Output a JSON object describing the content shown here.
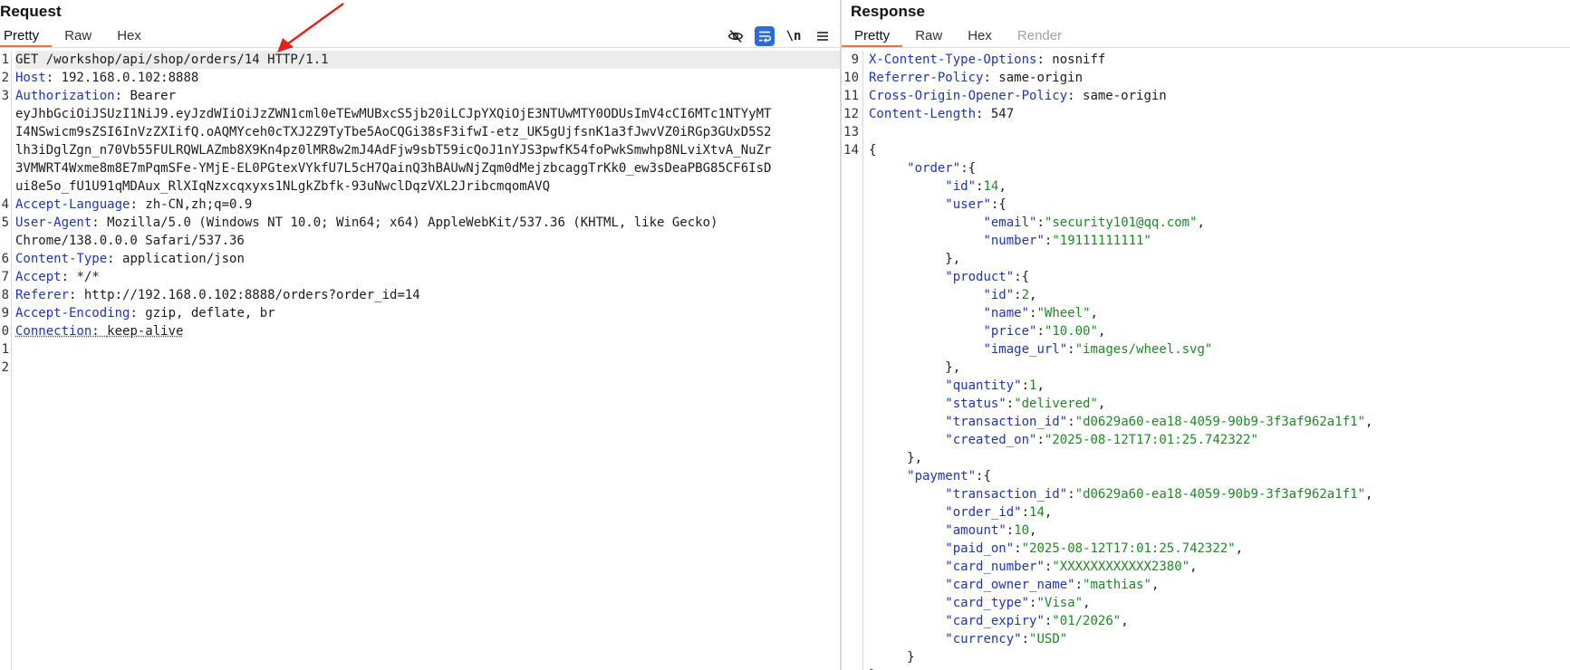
{
  "request": {
    "title": "Request",
    "tabs": [
      {
        "label": "Pretty",
        "active": true
      },
      {
        "label": "Raw",
        "active": false
      },
      {
        "label": "Hex",
        "active": false
      }
    ],
    "toolbar": {
      "hide_icon": "eye-slash-icon",
      "wrap_icon": "word-wrap-icon",
      "newline_label": "\\n",
      "menu_icon": "hamburger-menu-icon",
      "accent": "#2d6bd6"
    },
    "gutter": [
      "1",
      "2",
      "3",
      "",
      "",
      "",
      "",
      "",
      "4",
      "5",
      "",
      "6",
      "7",
      "8",
      "9",
      "0",
      "1",
      "2"
    ],
    "lines": [
      {
        "type": "request-line",
        "text": "GET /workshop/api/shop/orders/14 HTTP/1.1"
      },
      {
        "type": "header",
        "name": "Host",
        "value": "192.168.0.102:8888"
      },
      {
        "type": "header",
        "name": "Authorization",
        "value": "Bearer"
      },
      {
        "type": "cont",
        "text": "eyJhbGciOiJSUzI1NiJ9.eyJzdWIiOiJzZWN1cml0eTEwMUBxcS5jb20iLCJpYXQiOjE3NTUwMTY0ODUsImV4cCI6MTc1NTYyMT"
      },
      {
        "type": "cont",
        "text": "I4NSwicm9sZSI6InVzZXIifQ.oAQMYceh0cTXJ2Z9TyTbe5AoCQGi38sF3ifwI-etz_UK5gUjfsnK1a3fJwvVZ0iRGp3GUxD5S2"
      },
      {
        "type": "cont",
        "text": "lh3iDglZgn_n70Vb55FULRQWLAZmb8X9Kn4pz0lMR8w2mJ4AdFjw9sbT59icQoJ1nYJS3pwfK54foPwkSmwhp8NLviXtvA_NuZr"
      },
      {
        "type": "cont",
        "text": "3VMWRT4Wxme8m8E7mPqmSFe-YMjE-EL0PGtexVYkfU7L5cH7QainQ3hBAUwNjZqm0dMejzbcaggTrKk0_ew3sDeaPBG85CF6IsD"
      },
      {
        "type": "cont",
        "text": "ui8e5o_fU1U91qMDAux_RlXIqNzxcqxyxs1NLgkZbfk-93uNwclDqzVXL2JribcmqomAVQ"
      },
      {
        "type": "header",
        "name": "Accept-Language",
        "value": "zh-CN,zh;q=0.9"
      },
      {
        "type": "header",
        "name": "User-Agent",
        "value": "Mozilla/5.0 (Windows NT 10.0; Win64; x64) AppleWebKit/537.36 (KHTML, like Gecko)"
      },
      {
        "type": "cont",
        "text": "Chrome/138.0.0.0 Safari/537.36"
      },
      {
        "type": "header",
        "name": "Content-Type",
        "value": "application/json"
      },
      {
        "type": "header",
        "name": "Accept",
        "value": "*/*"
      },
      {
        "type": "header",
        "name": "Referer",
        "value": "http://192.168.0.102:8888/orders?order_id=14"
      },
      {
        "type": "header",
        "name": "Accept-Encoding",
        "value": "gzip, deflate, br"
      },
      {
        "type": "header",
        "name": "Connection",
        "value": "keep-alive",
        "underline": true
      },
      {
        "type": "blank"
      },
      {
        "type": "blank"
      }
    ]
  },
  "response": {
    "title": "Response",
    "tabs": [
      {
        "label": "Pretty",
        "active": true
      },
      {
        "label": "Raw",
        "active": false
      },
      {
        "label": "Hex",
        "active": false
      },
      {
        "label": "Render",
        "active": false,
        "disabled": true
      }
    ],
    "lines": [
      {
        "n": "9",
        "type": "header",
        "name": "X-Content-Type-Options",
        "value": "nosniff"
      },
      {
        "n": "10",
        "type": "header",
        "name": "Referrer-Policy",
        "value": "same-origin"
      },
      {
        "n": "11",
        "type": "header",
        "name": "Cross-Origin-Opener-Policy",
        "value": "same-origin"
      },
      {
        "n": "12",
        "type": "header",
        "name": "Content-Length",
        "value": "547"
      },
      {
        "n": "13",
        "type": "blank"
      },
      {
        "n": "14",
        "type": "json",
        "indent": 0,
        "pre": "{"
      },
      {
        "n": "",
        "type": "json",
        "indent": 1,
        "key": "order",
        "pre": ":{"
      },
      {
        "n": "",
        "type": "json",
        "indent": 2,
        "key": "id",
        "num": "14",
        "post": ","
      },
      {
        "n": "",
        "type": "json",
        "indent": 2,
        "key": "user",
        "pre": ":{"
      },
      {
        "n": "",
        "type": "json",
        "indent": 3,
        "key": "email",
        "str": "security101@qq.com",
        "post": ","
      },
      {
        "n": "",
        "type": "json",
        "indent": 3,
        "key": "number",
        "str": "19111111111"
      },
      {
        "n": "",
        "type": "json",
        "indent": 2,
        "pre": "},"
      },
      {
        "n": "",
        "type": "json",
        "indent": 2,
        "key": "product",
        "pre": ":{"
      },
      {
        "n": "",
        "type": "json",
        "indent": 3,
        "key": "id",
        "num": "2",
        "post": ","
      },
      {
        "n": "",
        "type": "json",
        "indent": 3,
        "key": "name",
        "str": "Wheel",
        "post": ","
      },
      {
        "n": "",
        "type": "json",
        "indent": 3,
        "key": "price",
        "str": "10.00",
        "post": ","
      },
      {
        "n": "",
        "type": "json",
        "indent": 3,
        "key": "image_url",
        "str": "images/wheel.svg"
      },
      {
        "n": "",
        "type": "json",
        "indent": 2,
        "pre": "},"
      },
      {
        "n": "",
        "type": "json",
        "indent": 2,
        "key": "quantity",
        "num": "1",
        "post": ","
      },
      {
        "n": "",
        "type": "json",
        "indent": 2,
        "key": "status",
        "str": "delivered",
        "post": ","
      },
      {
        "n": "",
        "type": "json",
        "indent": 2,
        "key": "transaction_id",
        "str": "d0629a60-ea18-4059-90b9-3f3af962a1f1",
        "post": ","
      },
      {
        "n": "",
        "type": "json",
        "indent": 2,
        "key": "created_on",
        "str": "2025-08-12T17:01:25.742322"
      },
      {
        "n": "",
        "type": "json",
        "indent": 1,
        "pre": "},"
      },
      {
        "n": "",
        "type": "json",
        "indent": 1,
        "key": "payment",
        "pre": ":{"
      },
      {
        "n": "",
        "type": "json",
        "indent": 2,
        "key": "transaction_id",
        "str": "d0629a60-ea18-4059-90b9-3f3af962a1f1",
        "post": ","
      },
      {
        "n": "",
        "type": "json",
        "indent": 2,
        "key": "order_id",
        "num": "14",
        "post": ","
      },
      {
        "n": "",
        "type": "json",
        "indent": 2,
        "key": "amount",
        "num": "10",
        "post": ","
      },
      {
        "n": "",
        "type": "json",
        "indent": 2,
        "key": "paid_on",
        "str": "2025-08-12T17:01:25.742322",
        "post": ","
      },
      {
        "n": "",
        "type": "json",
        "indent": 2,
        "key": "card_number",
        "str": "XXXXXXXXXXXX2380",
        "post": ","
      },
      {
        "n": "",
        "type": "json",
        "indent": 2,
        "key": "card_owner_name",
        "str": "mathias",
        "post": ","
      },
      {
        "n": "",
        "type": "json",
        "indent": 2,
        "key": "card_type",
        "str": "Visa",
        "post": ","
      },
      {
        "n": "",
        "type": "json",
        "indent": 2,
        "key": "card_expiry",
        "str": "01/2026",
        "post": ","
      },
      {
        "n": "",
        "type": "json",
        "indent": 2,
        "key": "currency",
        "str": "USD"
      },
      {
        "n": "",
        "type": "json",
        "indent": 1,
        "pre": "}"
      },
      {
        "n": "",
        "type": "json",
        "indent": 0,
        "pre": "}"
      }
    ]
  },
  "annotation": {
    "icon": "red-arrow-icon",
    "color": "#e0241b"
  }
}
